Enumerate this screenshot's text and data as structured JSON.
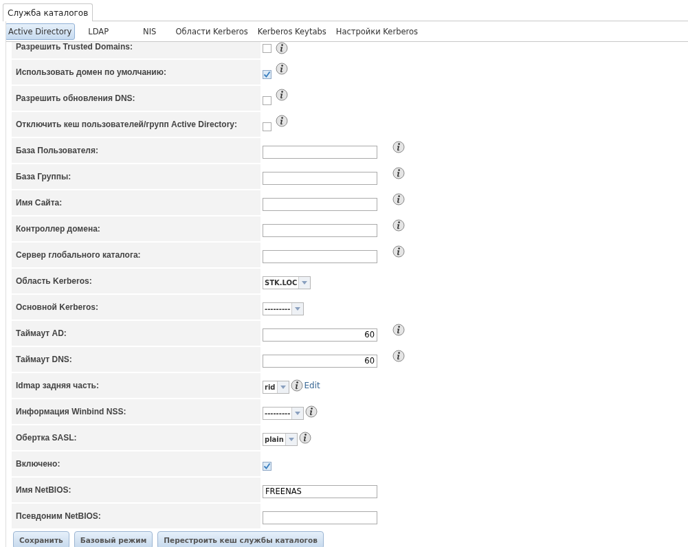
{
  "top_tabs": [
    {
      "label": "Служба каталогов",
      "selected": true
    }
  ],
  "sub_tabs": [
    {
      "label": "Active Directory",
      "selected": true
    },
    {
      "label": "LDAP",
      "selected": false
    },
    {
      "label": "NIS",
      "selected": false
    },
    {
      "label": "Области Kerberos",
      "selected": false
    },
    {
      "label": "Kerberos Keytabs",
      "selected": false
    },
    {
      "label": "Настройки Kerberos",
      "selected": false
    }
  ],
  "form_rows": [
    {
      "kind": "checkbox",
      "label": "Разрешить Trusted Domains:",
      "checked": false,
      "info": true
    },
    {
      "kind": "checkbox",
      "label": "Использовать домен по умолчанию:",
      "checked": true,
      "info": true
    },
    {
      "kind": "checkbox",
      "label": "Разрешить обновления DNS:",
      "checked": false,
      "info": true
    },
    {
      "kind": "checkbox",
      "label": "Отключить кеш пользователей/групп Active Directory:",
      "checked": false,
      "info": true
    },
    {
      "kind": "text",
      "label": "База Пользователя:",
      "info": true
    },
    {
      "kind": "text",
      "label": "База Группы:",
      "info": true
    },
    {
      "kind": "text",
      "label": "Имя Сайта:",
      "info": true
    },
    {
      "kind": "text",
      "label": "Контроллер домена:",
      "info": true
    },
    {
      "kind": "text",
      "label": "Сервер глобального каталога:",
      "info": true
    },
    {
      "kind": "select",
      "label": "Область Kerberos:",
      "value": "STK.LOC",
      "info": false
    },
    {
      "kind": "select",
      "label": "Основной Kerberos:",
      "value": "---------",
      "info": false
    },
    {
      "kind": "number",
      "label": "Таймаут AD:",
      "value": "60",
      "info": true
    },
    {
      "kind": "number",
      "label": "Таймаут DNS:",
      "value": "60",
      "info": true
    },
    {
      "kind": "select",
      "label": "Idmap задняя часть:",
      "value": "rid",
      "info": true,
      "link": "Edit"
    },
    {
      "kind": "select",
      "label": "Информация Winbind NSS:",
      "value": "---------",
      "info": true
    },
    {
      "kind": "select",
      "label": "Обертка SASL:",
      "value": "plain",
      "info": true
    },
    {
      "kind": "checkbox",
      "label": "Включено:",
      "checked": true,
      "info": false
    },
    {
      "kind": "text",
      "label": "Имя NetBIOS:",
      "value": "FREENAS",
      "info": false
    },
    {
      "kind": "text",
      "label": "Псевдоним NetBIOS:",
      "info": false
    }
  ],
  "buttons": [
    "Сохранить",
    "Базовый режим",
    "Перестроить кеш службы каталогов"
  ]
}
